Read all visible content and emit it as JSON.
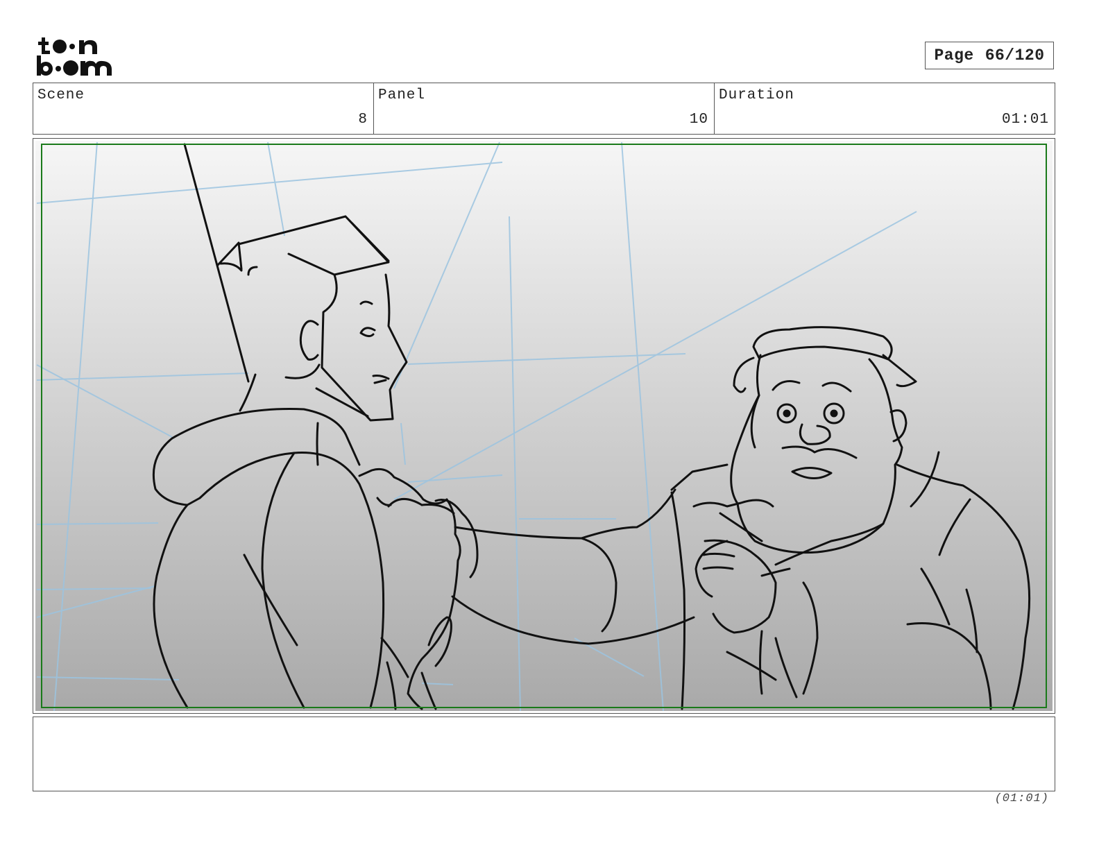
{
  "header": {
    "logo": {
      "icon": "toonboom-logo",
      "text": "toon boom"
    },
    "page_label": "Page",
    "page_number": "66/120"
  },
  "info": {
    "scene_label": "Scene",
    "scene_value": "8",
    "panel_label": "Panel",
    "panel_value": "10",
    "duration_label": "Duration",
    "duration_value": "01:01"
  },
  "panel_image": {
    "icon": "storyboard-sketch",
    "safe_frame_color": "#1a7a1a",
    "guide_line_color": "#9cc4e0"
  },
  "notes": {
    "text": ""
  },
  "footer": {
    "duration": "(01:01)"
  }
}
